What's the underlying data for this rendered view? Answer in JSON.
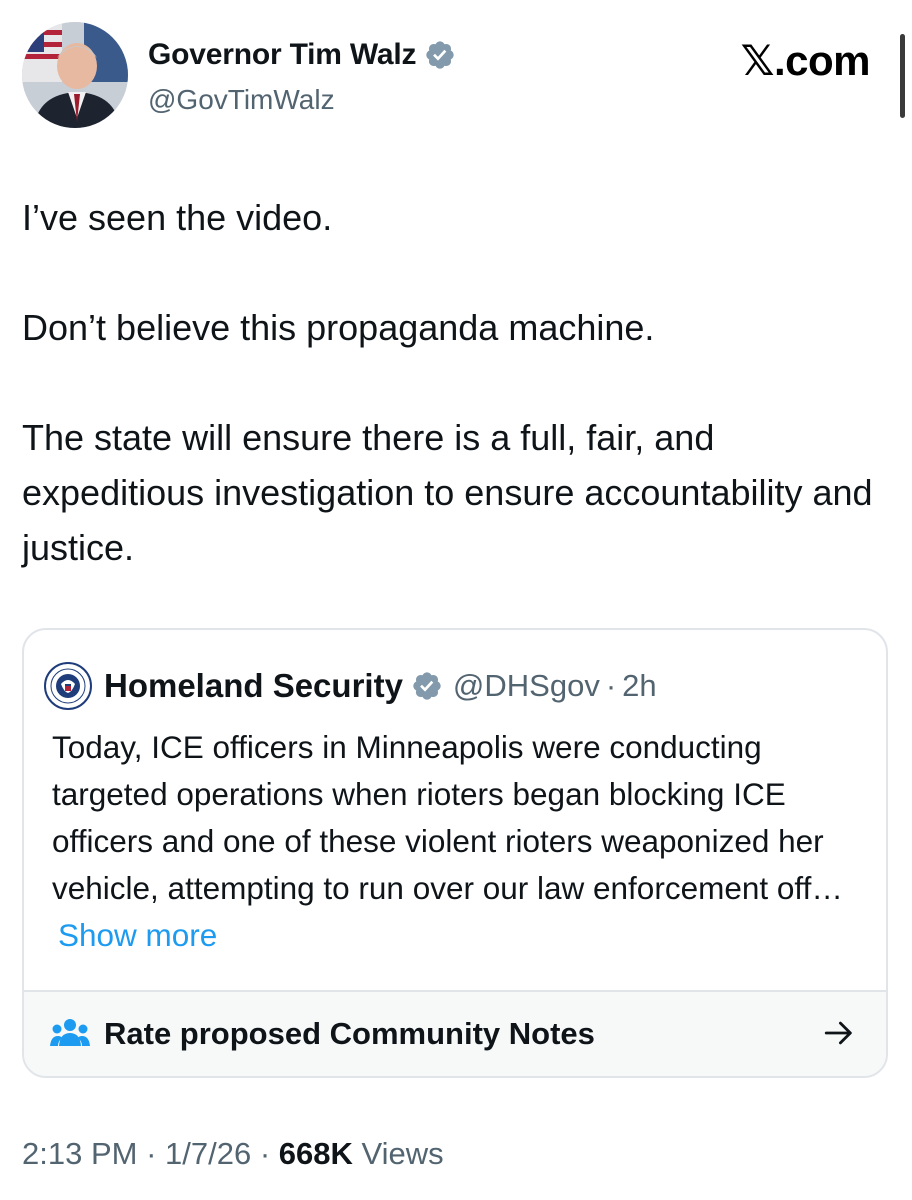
{
  "author": {
    "name": "Governor Tim Walz",
    "handle": "@GovTimWalz",
    "avatar_icon": "person-portrait-icon",
    "verified_icon": "verified-badge-icon"
  },
  "brand": {
    "label": "𝕏.com"
  },
  "tweet": {
    "paragraphs": [
      "I’ve seen the video.",
      "Don’t believe this propaganda machine.",
      "The state will ensure there is a full, fair, and expeditious investigation to ensure accountability and justice."
    ]
  },
  "quoted": {
    "name": "Homeland Security",
    "handle": "@DHSgov",
    "separator": "·",
    "time": "2h",
    "avatar_icon": "dhs-seal-icon",
    "text": "Today, ICE officers in Minneapolis were conducting targeted operations when rioters began blocking ICE officers and one of these violent rioters weaponized her vehicle, attempting to run over our law enforcement off…",
    "show_more": "Show more",
    "community_notes": {
      "label": "Rate proposed Community Notes",
      "icon": "people-group-icon",
      "arrow_icon": "arrow-right-icon"
    }
  },
  "meta": {
    "time": "2:13 PM",
    "sep1": " · ",
    "date": "1/7/26",
    "sep2": " · ",
    "views_count": "668K",
    "views_label": " Views"
  },
  "colors": {
    "link": "#1d9bf0",
    "verified": "#829aab",
    "secondary_text": "#536471",
    "primary_text": "#0f1419",
    "border": "#e1e5ea"
  }
}
